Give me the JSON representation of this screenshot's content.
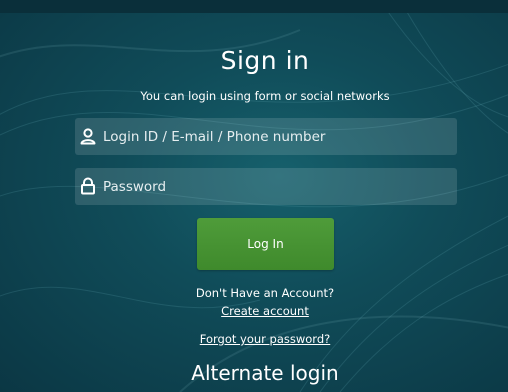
{
  "header": {
    "title": "Sign in",
    "subtitle": "You can login using form or social networks"
  },
  "form": {
    "login": {
      "icon": "user-icon",
      "placeholder": "Login ID / E-mail / Phone number",
      "value": ""
    },
    "password": {
      "icon": "lock-icon",
      "placeholder": "Password",
      "value": ""
    },
    "submit_label": "Log In"
  },
  "footer": {
    "no_account_text": "Don't Have an Account?",
    "create_account_label": "Create account",
    "forgot_password_label": "Forgot your password?",
    "alternate_login_heading": "Alternate login"
  },
  "colors": {
    "background": "#0e3f4c",
    "button": "#4a9636",
    "text": "#ffffff"
  }
}
